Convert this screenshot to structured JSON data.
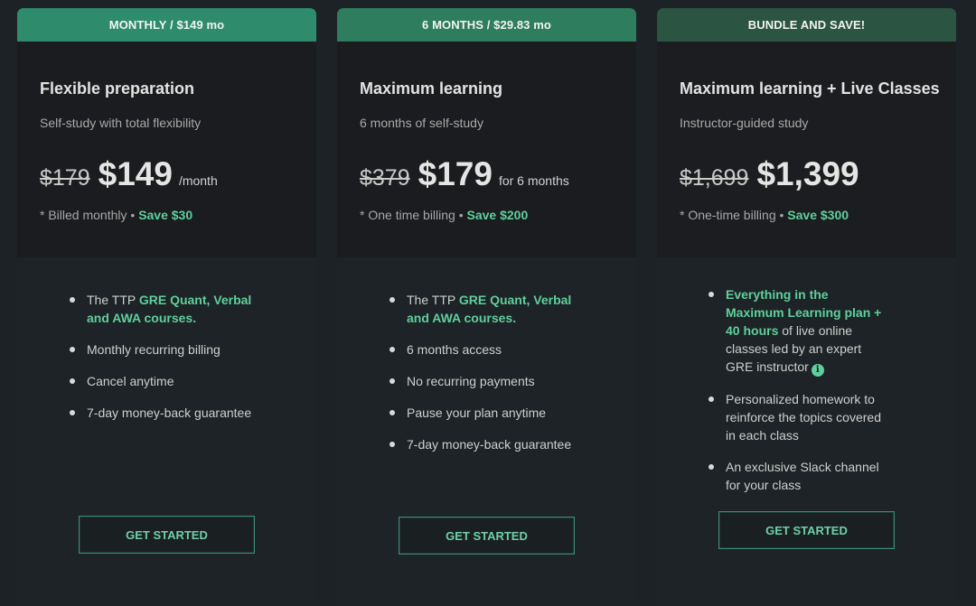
{
  "plans": [
    {
      "tab": "MONTHLY / $149 mo",
      "name": "Flexible preparation",
      "subtitle": "Self-study with total flexibility",
      "old_price": "$179",
      "price": "$149",
      "period": "/month",
      "billing_note": "* Billed monthly",
      "separator": "•",
      "savings": "Save $30",
      "features": [
        {
          "plain_before": "The TTP ",
          "highlight": "GRE Quant, Verbal and AWA courses.",
          "plain_after": ""
        },
        {
          "plain_before": "Monthly recurring billing",
          "highlight": "",
          "plain_after": ""
        },
        {
          "plain_before": "Cancel anytime",
          "highlight": "",
          "plain_after": ""
        },
        {
          "plain_before": "7-day money-back guarantee",
          "highlight": "",
          "plain_after": ""
        }
      ],
      "cta": "GET STARTED"
    },
    {
      "tab": "6 MONTHS / $29.83 mo",
      "name": "Maximum learning",
      "subtitle": "6 months of self-study",
      "old_price": "$379",
      "price": "$179",
      "period": "for 6 months",
      "billing_note": "* One time billing",
      "separator": "•",
      "savings": "Save $200",
      "features": [
        {
          "plain_before": "The TTP ",
          "highlight": "GRE Quant, Verbal and AWA courses.",
          "plain_after": ""
        },
        {
          "plain_before": "6 months access",
          "highlight": "",
          "plain_after": ""
        },
        {
          "plain_before": "No recurring payments",
          "highlight": "",
          "plain_after": ""
        },
        {
          "plain_before": "Pause your plan anytime",
          "highlight": "",
          "plain_after": ""
        },
        {
          "plain_before": "7-day money-back guarantee",
          "highlight": "",
          "plain_after": ""
        }
      ],
      "cta": "GET STARTED"
    },
    {
      "tab": "BUNDLE AND SAVE!",
      "name": "Maximum learning + Live Classes",
      "subtitle": "Instructor-guided study",
      "old_price": "$1,699",
      "price": "$1,399",
      "period": "",
      "billing_note": "* One-time billing",
      "separator": "•",
      "savings": "Save $300",
      "features": [
        {
          "plain_before": "",
          "highlight": "Everything in the Maximum Learning plan + 40 hours",
          "plain_after": " of live online classes led by an expert GRE instructor",
          "info_icon": "i"
        },
        {
          "plain_before": "Personalized homework to reinforce the topics covered in each class",
          "highlight": "",
          "plain_after": ""
        },
        {
          "plain_before": "An exclusive Slack channel for your class",
          "highlight": "",
          "plain_after": ""
        }
      ],
      "cta": "GET STARTED"
    }
  ],
  "colors": {
    "accent_green": "#5fcf9c",
    "tab_monthly": "#2e8c6c",
    "tab_six_months": "#2e7d5e",
    "tab_bundle": "#2b5443",
    "background": "#1c2225"
  }
}
